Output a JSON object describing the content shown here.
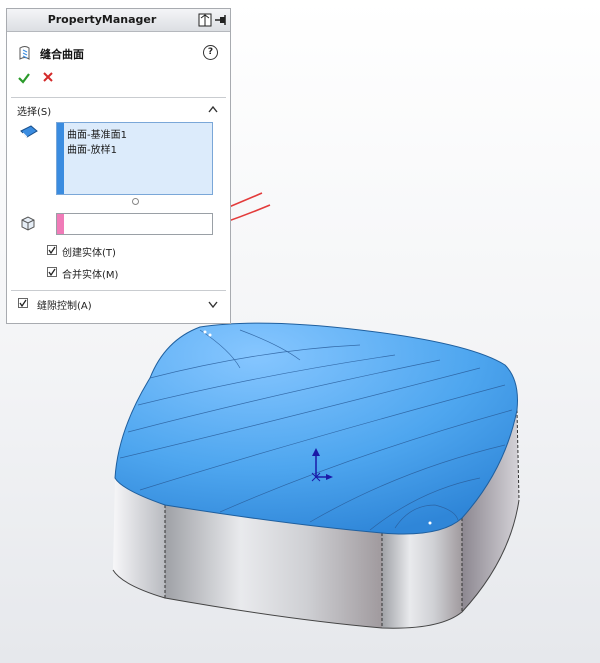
{
  "property_manager": {
    "title": "PropertyManager",
    "feature_title": "缝合曲面",
    "ok_icon": "check-icon",
    "cancel_icon": "x-icon",
    "help_label": "?"
  },
  "selections": {
    "header": "选择(S)",
    "items": [
      "曲面-基准面1",
      "曲面-放样1"
    ],
    "stripe_color": "#3a8ce0",
    "second_stripe_color": "#f07bb8"
  },
  "options": {
    "create_solid": {
      "label": "创建实体(T)",
      "checked": true
    },
    "merge_solid": {
      "label": "合并实体(M)",
      "checked": true
    }
  },
  "gap_control": {
    "label": "缝隙控制(A)",
    "checked": true
  },
  "colors": {
    "surface_blue": "#4ea6ef",
    "arrow_red": "#e33b3b"
  }
}
